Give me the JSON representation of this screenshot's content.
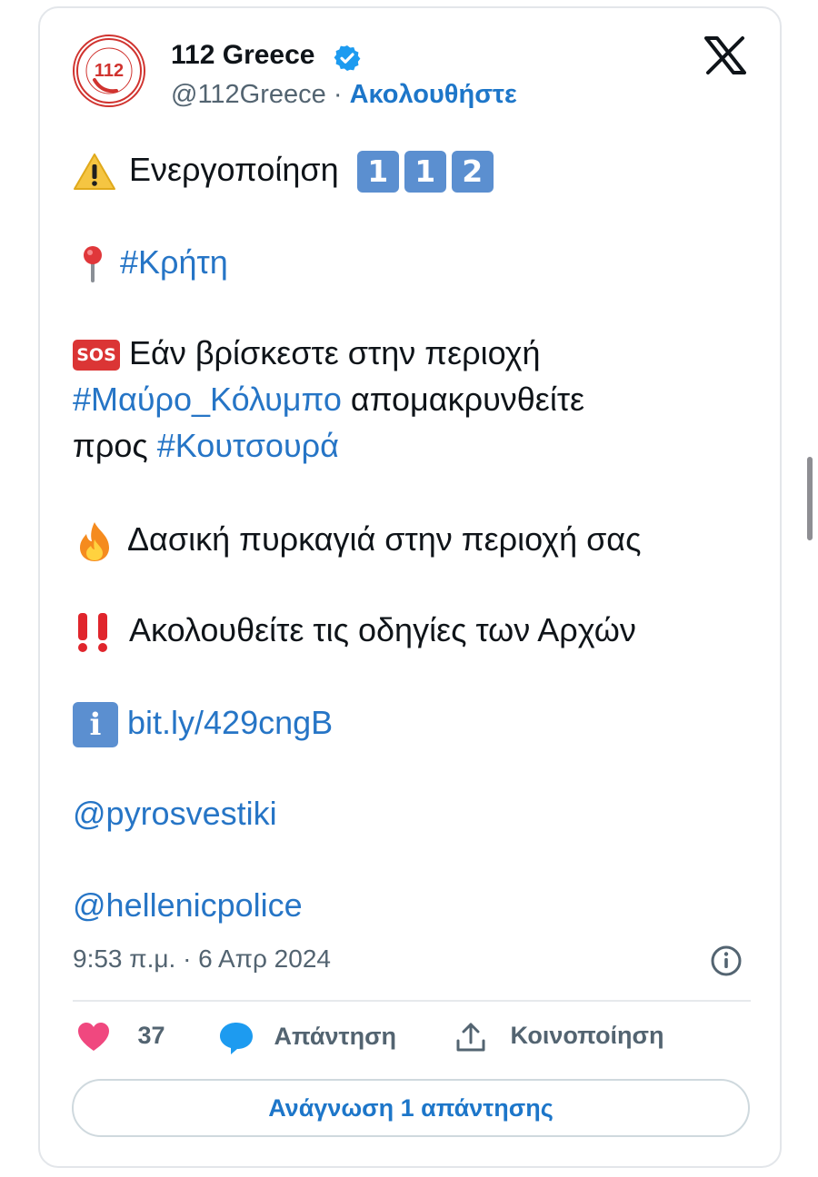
{
  "account": {
    "name": "112 Greece",
    "handle": "@112Greece",
    "separator": "·",
    "follow_label": "Ακολουθήστε",
    "avatar_text": "112",
    "verified": true
  },
  "platform_icon": "x-logo-icon",
  "tweet": {
    "line1": {
      "emoji": "warning-icon",
      "text": "Ενεργοποίηση",
      "keycaps": [
        "1",
        "1",
        "2"
      ]
    },
    "line2": {
      "emoji": "round-pushpin-icon",
      "hashtag": "#Κρήτη"
    },
    "line3": {
      "emoji": "sos-icon",
      "emoji_text": "SOS",
      "text": "Εάν βρίσκεστε στην περιοχή"
    },
    "line4": {
      "hashtag": "#Μαύρο_Κόλυμπο",
      "text": "απομακρυνθείτε"
    },
    "line5": {
      "text": "προς",
      "hashtag": "#Κουτσουρά"
    },
    "line6": {
      "emoji": "fire-icon",
      "text": "Δασική πυρκαγιά στην περιοχή σας"
    },
    "line7": {
      "emoji": "double-exclamation-icon",
      "text": "Ακολουθείτε τις οδηγίες των Αρχών"
    },
    "line8": {
      "emoji": "information-icon",
      "emoji_text": "i",
      "link": "bit.ly/429cngB"
    },
    "mention1": "@pyrosvestiki",
    "mention2": "@hellenicpolice"
  },
  "timestamp": "9:53 π.μ. · 6 Απρ 2024",
  "actions": {
    "likes_count": "37",
    "reply_label": "Απάντηση",
    "share_label": "Κοινοποίηση"
  },
  "read_replies_label": "Ανάγνωση 1 απάντησης",
  "colors": {
    "link": "#2675c6",
    "follow": "#1d76c9",
    "heart": "#f0487f",
    "reply_bubble": "#1d9bf0",
    "verified": "#1d9bf0",
    "keycap": "#5b8fd0",
    "sos": "#db3535"
  }
}
